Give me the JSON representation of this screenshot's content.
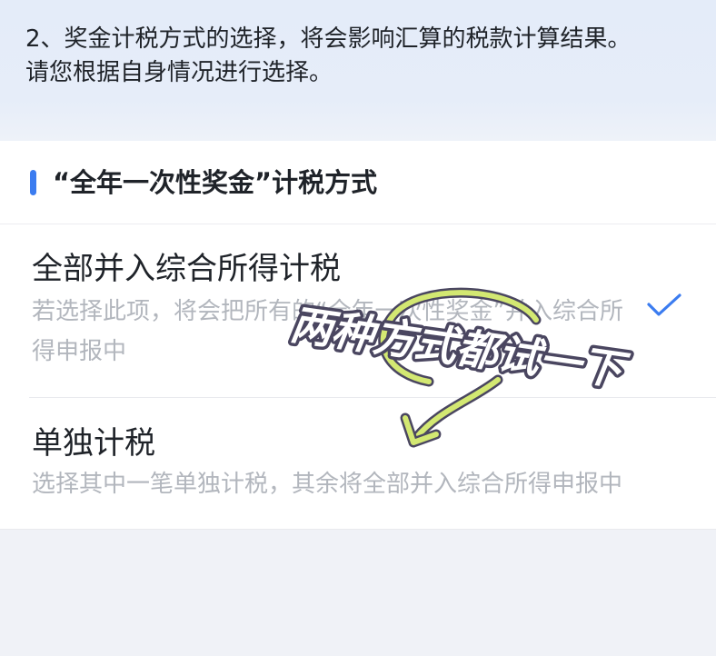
{
  "notice": {
    "line1": "2、奖金计税方式的选择，将会影响汇算的税款计算结果。",
    "line2": "请您根据自身情况进行选择。"
  },
  "section": {
    "title": "“全年一次性奖金”计税方式"
  },
  "options": [
    {
      "title": "全部并入综合所得计税",
      "desc": "若选择此项，将会把所有的“全年一次性奖金”并入综合所得申报中",
      "selected": true
    },
    {
      "title": "单独计税",
      "desc": "选择其中一笔单独计税，其余将全部并入综合所得申报中",
      "selected": false
    }
  ],
  "overlay": {
    "caption": "两种方式都试一下",
    "arrow_icon": "curved-arrow-icon"
  },
  "icons": {
    "selected": "checkmark-icon"
  },
  "colors": {
    "accent": "#3b7cf0",
    "text": "#1f2329",
    "muted": "#b2b6bd",
    "top_background": "#e4ecf9",
    "arrow": "#d3e872"
  }
}
